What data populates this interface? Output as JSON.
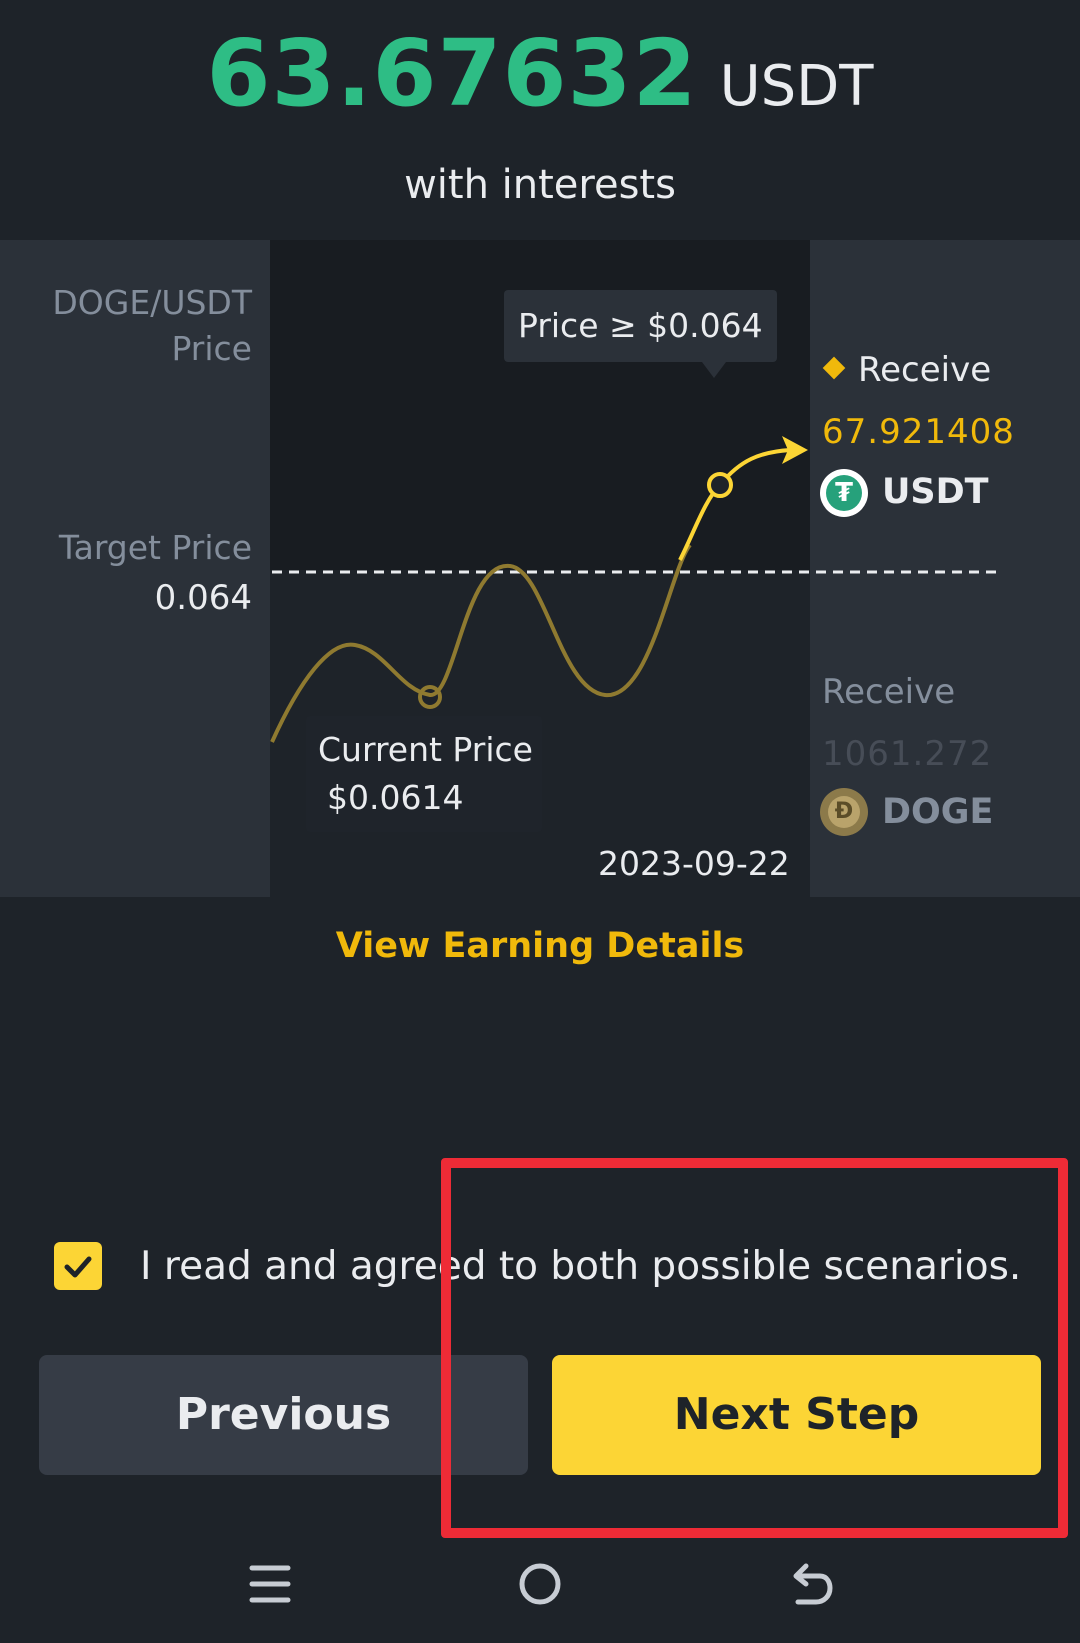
{
  "header": {
    "amount": "63.67632",
    "unit": "USDT",
    "subtitle": "with interests"
  },
  "chart": {
    "y_axis_label_line1": "DOGE/USDT",
    "y_axis_label_line2": "Price",
    "target_label": "Target Price",
    "target_value": "0.064",
    "tooltip_target": "Price ≥ $0.064",
    "current_label": "Current Price",
    "current_value": "$0.0614",
    "end_date": "2023-09-22"
  },
  "scenarios": {
    "high": {
      "label": "Receive",
      "amount": "67.921408",
      "asset": "USDT",
      "coin_icon": "usdt-coin-icon"
    },
    "low": {
      "label": "Receive",
      "amount": "1061.272",
      "asset": "DOGE",
      "coin_icon": "doge-coin-icon"
    }
  },
  "links": {
    "view_details": "View Earning Details"
  },
  "agreement": {
    "checked": true,
    "text": "I read and agreed to both possible scenarios."
  },
  "buttons": {
    "previous": "Previous",
    "next": "Next Step"
  },
  "nav": {
    "icons": [
      "menu-icon",
      "home-icon",
      "back-icon"
    ]
  },
  "colors": {
    "background": "#1e2329",
    "panel": "#2b3139",
    "green": "#2ebd85",
    "yellow": "#fcd535",
    "gold": "#f0b90b",
    "highlight": "#ee2b36"
  }
}
